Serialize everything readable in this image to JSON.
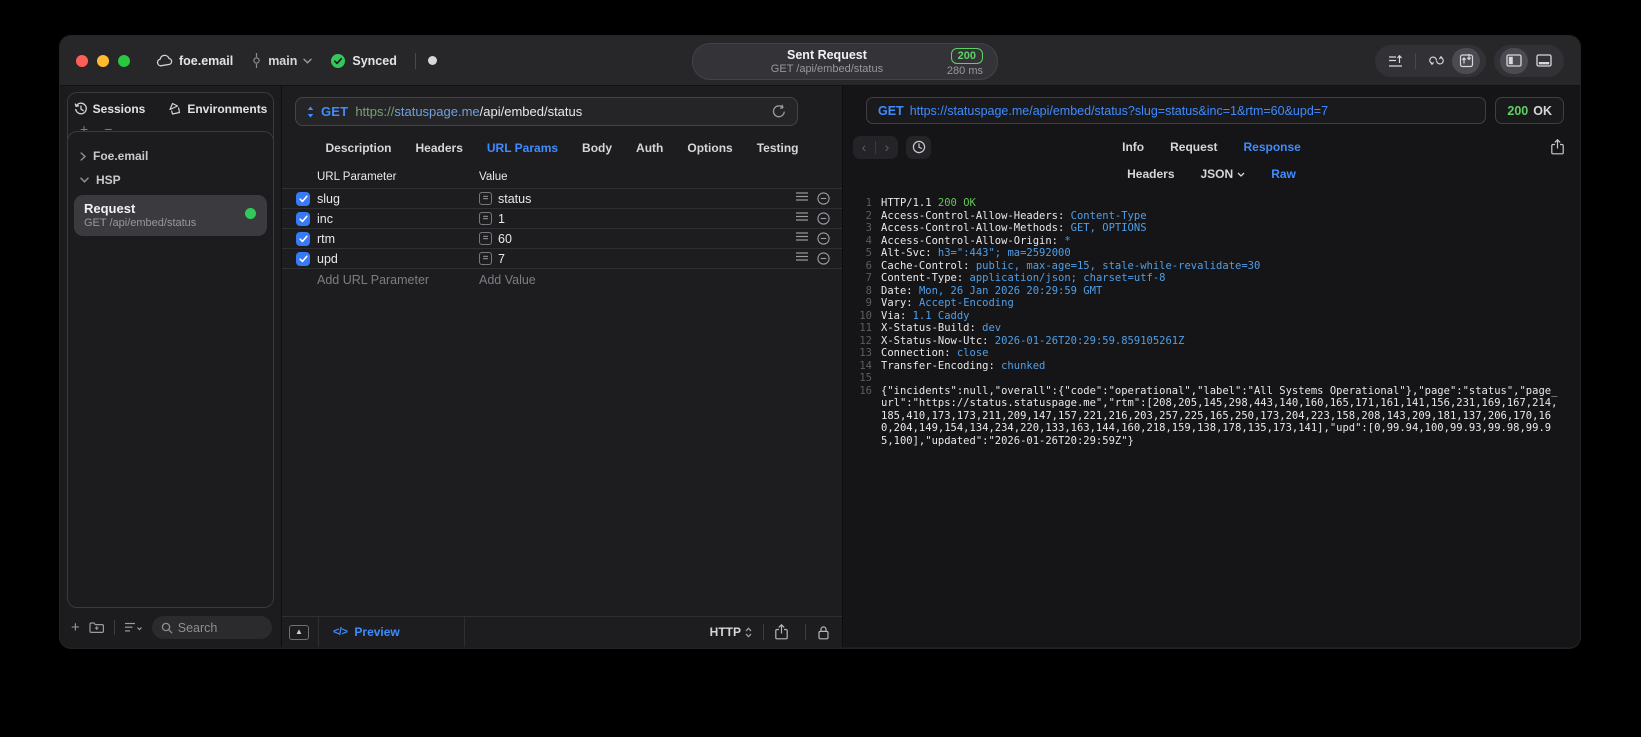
{
  "titlebar": {
    "project": "foe.email",
    "branch": "main",
    "sync_label": "Synced",
    "center": {
      "title": "Sent Request",
      "subtitle": "GET /api/embed/status",
      "status_code": "200",
      "duration": "280 ms"
    }
  },
  "sidebar": {
    "tabs": [
      {
        "label": "Sessions",
        "icon": "history-icon"
      },
      {
        "label": "Environments",
        "icon": "environments-icon"
      }
    ],
    "groups": [
      {
        "label": "Foe.email",
        "expanded": false
      },
      {
        "label": "HSP",
        "expanded": true
      }
    ],
    "request_item": {
      "title": "Request",
      "subtitle": "GET /api/embed/status",
      "selected": true,
      "status_dot_color": "#34c759"
    },
    "search_placeholder": "Search"
  },
  "request_panel": {
    "method": "GET",
    "url": {
      "scheme": "https://",
      "host": "statuspage.me",
      "path": "/api/embed/status"
    },
    "tabs": [
      "Description",
      "Headers",
      "URL Params",
      "Body",
      "Auth",
      "Options",
      "Testing"
    ],
    "active_tab": "URL Params",
    "params": {
      "columns": [
        "URL Parameter",
        "Value"
      ],
      "rows": [
        {
          "enabled": true,
          "name": "slug",
          "value": "status"
        },
        {
          "enabled": true,
          "name": "inc",
          "value": "1"
        },
        {
          "enabled": true,
          "name": "rtm",
          "value": "60"
        },
        {
          "enabled": true,
          "name": "upd",
          "value": "7"
        }
      ],
      "add_name_placeholder": "Add URL Parameter",
      "add_value_placeholder": "Add Value"
    },
    "footer": {
      "preview_label": "Preview",
      "code_glyph": "</>",
      "protocol": "HTTP"
    }
  },
  "response_panel": {
    "method": "GET",
    "url": "https://statuspage.me/api/embed/status?slug=status&inc=1&rtm=60&upd=7",
    "status_code": "200",
    "status_text": "OK",
    "tabs": [
      "Info",
      "Request",
      "Response"
    ],
    "active_tab": "Response",
    "view_tabs": [
      "Headers",
      "JSON",
      "Raw"
    ],
    "active_view_tab": "Raw",
    "body_lines": [
      {
        "num": "1",
        "parts": [
          {
            "text": "HTTP/1.1 ",
            "color": "plain"
          },
          {
            "text": "200 OK",
            "color": "green"
          }
        ]
      },
      {
        "num": "2",
        "parts": [
          {
            "text": "Access-Control-Allow-Headers: ",
            "color": "plain"
          },
          {
            "text": "Content-Type",
            "color": "blue"
          }
        ]
      },
      {
        "num": "3",
        "parts": [
          {
            "text": "Access-Control-Allow-Methods: ",
            "color": "plain"
          },
          {
            "text": "GET, OPTIONS",
            "color": "blue"
          }
        ]
      },
      {
        "num": "4",
        "parts": [
          {
            "text": "Access-Control-Allow-Origin: ",
            "color": "plain"
          },
          {
            "text": "*",
            "color": "blue"
          }
        ]
      },
      {
        "num": "5",
        "parts": [
          {
            "text": "Alt-Svc: ",
            "color": "plain"
          },
          {
            "text": "h3=\":443\"; ma=2592000",
            "color": "blue"
          }
        ]
      },
      {
        "num": "6",
        "parts": [
          {
            "text": "Cache-Control: ",
            "color": "plain"
          },
          {
            "text": "public, max-age=15, stale-while-revalidate=30",
            "color": "blue"
          }
        ]
      },
      {
        "num": "7",
        "parts": [
          {
            "text": "Content-Type: ",
            "color": "plain"
          },
          {
            "text": "application/json; charset=utf-8",
            "color": "blue"
          }
        ]
      },
      {
        "num": "8",
        "parts": [
          {
            "text": "Date: ",
            "color": "plain"
          },
          {
            "text": "Mon, 26 Jan 2026 20:29:59 GMT",
            "color": "blue"
          }
        ]
      },
      {
        "num": "9",
        "parts": [
          {
            "text": "Vary: ",
            "color": "plain"
          },
          {
            "text": "Accept-Encoding",
            "color": "blue"
          }
        ]
      },
      {
        "num": "10",
        "parts": [
          {
            "text": "Via: ",
            "color": "plain"
          },
          {
            "text": "1.1 Caddy",
            "color": "blue"
          }
        ]
      },
      {
        "num": "11",
        "parts": [
          {
            "text": "X-Status-Build: ",
            "color": "plain"
          },
          {
            "text": "dev",
            "color": "blue"
          }
        ]
      },
      {
        "num": "12",
        "parts": [
          {
            "text": "X-Status-Now-Utc: ",
            "color": "plain"
          },
          {
            "text": "2026-01-26T20:29:59.859105261Z",
            "color": "blue"
          }
        ]
      },
      {
        "num": "13",
        "parts": [
          {
            "text": "Connection: ",
            "color": "plain"
          },
          {
            "text": "close",
            "color": "blue"
          }
        ]
      },
      {
        "num": "14",
        "parts": [
          {
            "text": "Transfer-Encoding: ",
            "color": "plain"
          },
          {
            "text": "chunked",
            "color": "blue"
          }
        ]
      },
      {
        "num": "15",
        "parts": []
      },
      {
        "num": "16",
        "wrap": true,
        "parts": [
          {
            "text": "{\"incidents\":null,\"overall\":{\"code\":\"operational\",\"label\":\"All Systems Operational\"},\"page\":\"status\",\"page_url\":\"https://status.statuspage.me\",\"rtm\":[208,205,145,298,443,140,160,165,171,161,141,156,231,169,167,214,185,410,173,173,211,209,147,157,221,216,203,257,225,165,250,173,204,223,158,208,143,209,181,137,206,170,160,204,149,154,134,234,220,133,163,144,160,218,159,138,178,135,173,141],\"upd\":[0,99.94,100,99.93,99.98,99.95,100],\"updated\":\"2026-01-26T20:29:59Z\"}",
            "color": "plain"
          }
        ]
      }
    ]
  },
  "colors": {
    "accent_blue": "#3f8cff",
    "value_blue": "#4f9fe8",
    "status_green": "#5fcf66",
    "response_green": "#62c554",
    "checkbox_blue": "#367bf5",
    "dot_green": "#34c759"
  }
}
